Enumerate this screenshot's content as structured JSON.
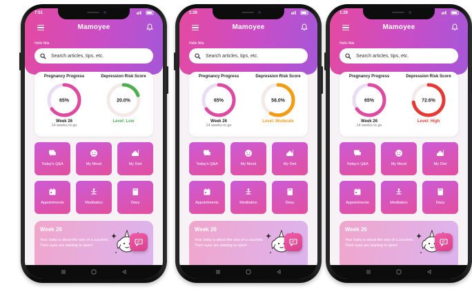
{
  "phones": [
    {
      "status_time": "7:51",
      "app_title": "Mamoyee",
      "greeting": "Hello Nila",
      "search_placeholder": "Search articles, tips, etc.",
      "pregnancy_title": "Pregnancy Progress",
      "pregnancy_percent_label": "65%",
      "pregnancy_fraction": 0.65,
      "week_label": "Week 26",
      "weeks_to_go": "14 weeks to go",
      "risk_title": "Depression Risk Score",
      "risk_percent_label": "20.0%",
      "risk_fraction": 0.2,
      "risk_level": "Level: Low",
      "risk_color": "#4caf50",
      "tiles": [
        "Today's Q&A",
        "My Mood",
        "My Diet",
        "Appointments",
        "Meditation",
        "Diary"
      ],
      "week_card_title": "Week 26",
      "week_card_text": "Your baby is about the size of a zucchini. Their eyes are starting to open!"
    },
    {
      "status_time": "1:26",
      "app_title": "Mamoyee",
      "greeting": "Hello Nila",
      "search_placeholder": "Search articles, tips, etc.",
      "pregnancy_title": "Pregnancy Progress",
      "pregnancy_percent_label": "65%",
      "pregnancy_fraction": 0.65,
      "week_label": "Week 26",
      "weeks_to_go": "14 weeks to go",
      "risk_title": "Depression Risk Score",
      "risk_percent_label": "58.0%",
      "risk_fraction": 0.58,
      "risk_level": "Level: Moderate",
      "risk_color": "#f39c12",
      "tiles": [
        "Today's Q&A",
        "My Mood",
        "My Diet",
        "Appointments",
        "Meditation",
        "Diary"
      ],
      "week_card_title": "Week 26",
      "week_card_text": "Your baby is about the size of a zucchini. Their eyes are starting to open!"
    },
    {
      "status_time": "1:29",
      "app_title": "Mamoyee",
      "greeting": "Hello Nila",
      "search_placeholder": "Search articles, tips, etc.",
      "pregnancy_title": "Pregnancy Progress",
      "pregnancy_percent_label": "65%",
      "pregnancy_fraction": 0.65,
      "week_label": "Week 26",
      "weeks_to_go": "14 weeks to go",
      "risk_title": "Depression Risk Score",
      "risk_percent_label": "72.6%",
      "risk_fraction": 0.726,
      "risk_level": "Level: High",
      "risk_color": "#e53935",
      "tiles": [
        "Today's Q&A",
        "My Mood",
        "My Diet",
        "Appointments",
        "Meditation",
        "Diary"
      ],
      "week_card_title": "Week 26",
      "week_card_text": "Your baby is about the size of a zucchini. Their eyes are starting to open!"
    }
  ],
  "colors": {
    "pregnancy_ring": "#dc4ba0",
    "pregnancy_track": "#eadcf3",
    "risk_track": "#f3e9e9"
  },
  "icons": [
    "menu-icon",
    "bell-icon",
    "search-icon",
    "chat-icon",
    "smile-icon",
    "food-icon",
    "calendar-icon",
    "meditation-icon",
    "book-icon",
    "unicorn-illustration",
    "message-icon"
  ]
}
